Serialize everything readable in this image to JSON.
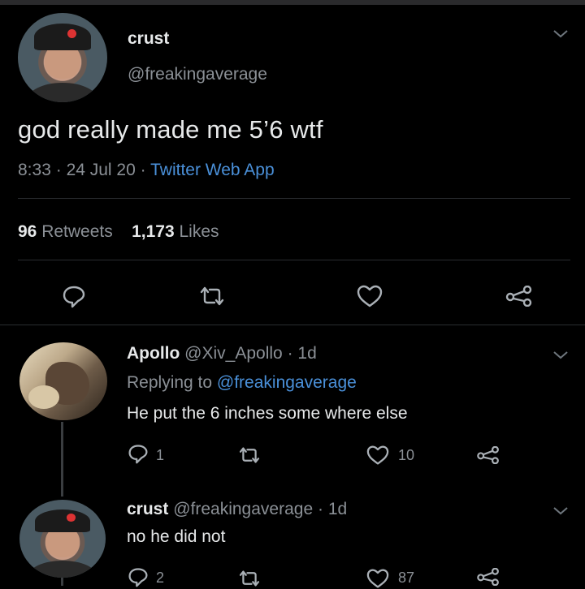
{
  "main_tweet": {
    "display_name": "crust",
    "handle": "@freakingaverage",
    "text": "god really made me 5’6 wtf",
    "time": "8:33",
    "date": "24 Jul 20",
    "source": "Twitter Web App",
    "retweets_count": "96",
    "retweets_label": "Retweets",
    "likes_count": "1,173",
    "likes_label": "Likes"
  },
  "replies": [
    {
      "display_name": "Apollo",
      "handle": "@Xiv_Apollo",
      "age": "1d",
      "replying_prefix": "Replying to",
      "replying_to": "@freakingaverage",
      "text": "He put the 6 inches some where else",
      "reply_count": "1",
      "like_count": "10"
    },
    {
      "display_name": "crust",
      "handle": "@freakingaverage",
      "age": "1d",
      "text": "no he did not",
      "reply_count": "2",
      "like_count": "87"
    }
  ],
  "separator": "·",
  "colors": {
    "background": "#000000",
    "text_primary": "#e7e9ea",
    "text_secondary": "#8b9096",
    "link": "#4a90d9",
    "divider": "#2a2d30"
  },
  "icons": [
    "reply-icon",
    "retweet-icon",
    "like-icon",
    "share-icon",
    "chevron-down-icon"
  ]
}
